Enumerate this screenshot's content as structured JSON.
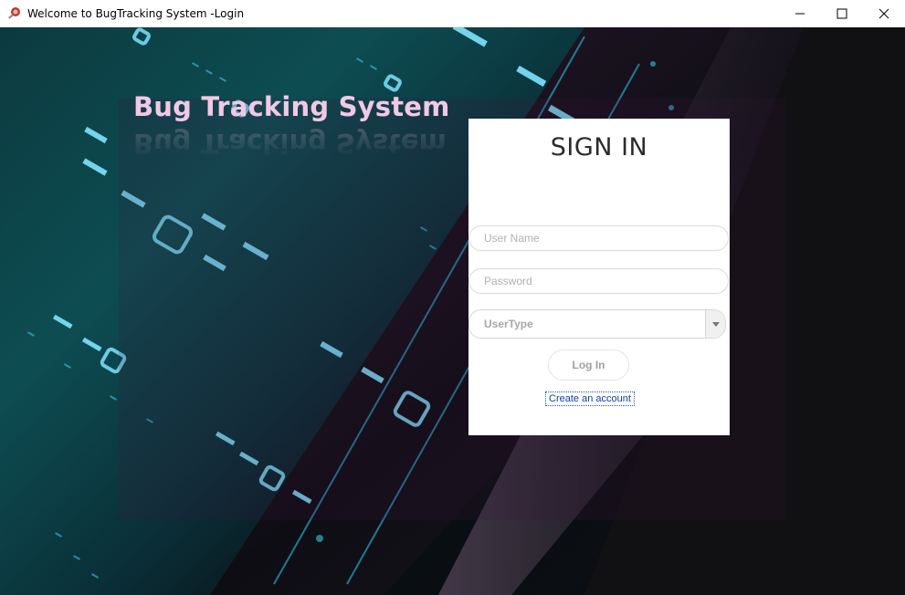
{
  "window": {
    "title": "Welcome to BugTracking System -Login",
    "controls": {
      "minimize": "minimize-icon",
      "maximize": "maximize-icon",
      "close": "close-icon"
    }
  },
  "brand": {
    "title": "Bug Tracking System",
    "color": "#f1c9e6"
  },
  "login": {
    "heading": "SIGN IN",
    "username": {
      "placeholder": "User Name",
      "value": ""
    },
    "password": {
      "placeholder": "Password",
      "value": ""
    },
    "usertype": {
      "selected": "UserType"
    },
    "login_button": "Log In",
    "create_account_link": "Create an account"
  },
  "colors": {
    "link": "#0b3fa5",
    "card_bg": "#ffffff",
    "accent_teal": "#0d4d52"
  }
}
